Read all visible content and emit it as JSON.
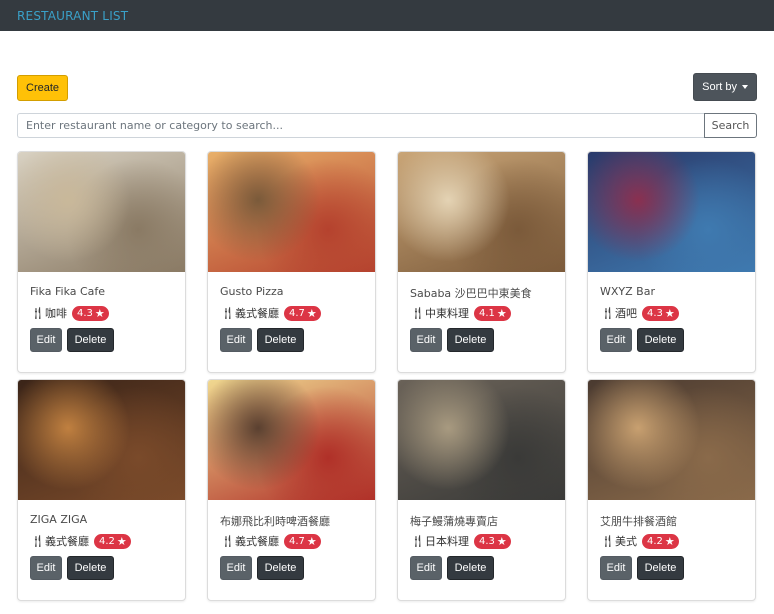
{
  "navbar": {
    "brand": "RESTAURANT LIST"
  },
  "toolbar": {
    "create_label": "Create",
    "sort_label": "Sort by"
  },
  "search": {
    "placeholder": "Enter restaurant name or category to search...",
    "button_label": "Search"
  },
  "card_actions": {
    "edit_label": "Edit",
    "delete_label": "Delete"
  },
  "icons": {
    "category": "utensils-icon",
    "rating": "star-icon",
    "sort": "caret-down-icon"
  },
  "colors": {
    "navbar": "#343a40",
    "brand": "#3aa0c8",
    "create": "#ffc107",
    "badge": "#dc3545",
    "edit": "#5a6268",
    "delete": "#343a40"
  },
  "restaurants": [
    {
      "name": "Fika Fika Cafe",
      "category": "咖啡",
      "rating": "4.3",
      "photo": [
        "#d9d2c3",
        "#8a7a64",
        "#c9b89a"
      ]
    },
    {
      "name": "Gusto Pizza",
      "category": "義式餐廳",
      "rating": "4.7",
      "photo": [
        "#e8b06a",
        "#b5422e",
        "#7a5a3a"
      ]
    },
    {
      "name": "Sababa 沙巴巴中東美食",
      "category": "中東料理",
      "rating": "4.1",
      "photo": [
        "#c9a577",
        "#7b5a3a",
        "#e4d3b4"
      ]
    },
    {
      "name": "WXYZ Bar",
      "category": "酒吧",
      "rating": "4.3",
      "photo": [
        "#2a3a6a",
        "#3f7ab0",
        "#8a3050"
      ]
    },
    {
      "name": "ZIGA ZIGA",
      "category": "義式餐廳",
      "rating": "4.2",
      "photo": [
        "#3a2418",
        "#7a4a2a",
        "#c08040"
      ]
    },
    {
      "name": "布娜飛比利時啤酒餐廳",
      "category": "義式餐廳",
      "rating": "4.7",
      "photo": [
        "#f0d890",
        "#b03028",
        "#5a4030"
      ]
    },
    {
      "name": "梅子鰻蒲燒專賣店",
      "category": "日本料理",
      "rating": "4.3",
      "photo": [
        "#6a6258",
        "#3a3a38",
        "#a89a80"
      ]
    },
    {
      "name": "艾朋牛排餐酒館",
      "category": "美式",
      "rating": "4.2",
      "photo": [
        "#4a3a30",
        "#8a6a4a",
        "#c8a070"
      ]
    }
  ]
}
